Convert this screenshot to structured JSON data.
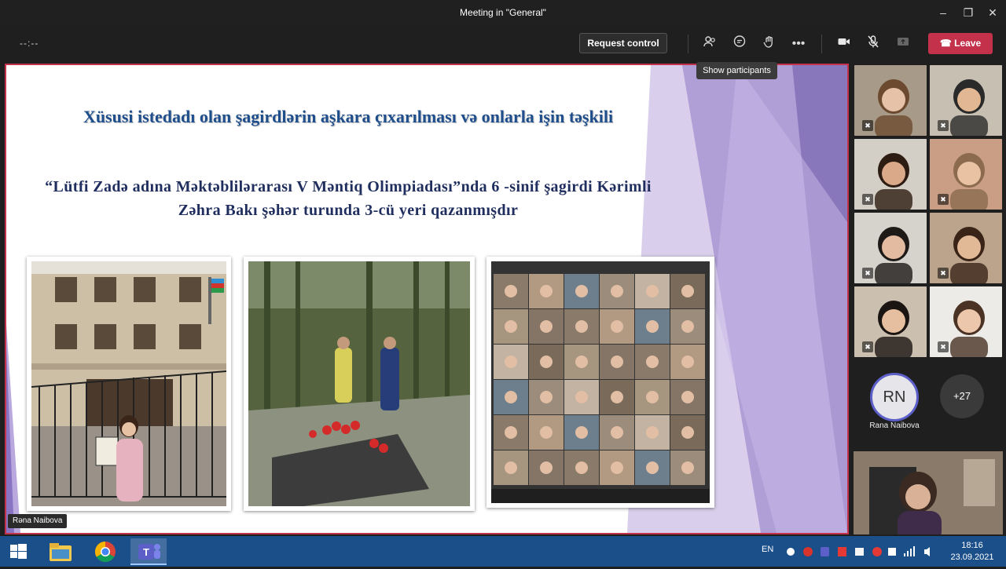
{
  "window": {
    "title": "Meeting in \"General\"",
    "minimize_icon": "minimize-icon",
    "restore_icon": "restore-icon",
    "close_icon": "close-icon"
  },
  "toolbar": {
    "timer": "--:--",
    "request_control": "Request control",
    "leave": "Leave",
    "tooltip": "Show participants",
    "icons": [
      "participants-icon",
      "chat-icon",
      "raise-hand-icon",
      "more-options-icon",
      "camera-icon",
      "mic-muted-icon",
      "share-icon"
    ]
  },
  "slide": {
    "title": "Xüsusi istedadı olan şagirdlərin aşkara çıxarılması və onlarla işin təşkili",
    "subtitle": "“Lütfi Zadə adına Məktəblilərarası  V Məntiq Olimpiadası”nda 6 -sinif şagirdi Kərimli Zəhra Bakı şəhər turunda 3-cü yeri qazanmışdır",
    "photos": [
      "school-building-photo",
      "memorial-photo",
      "video-call-collage-photo"
    ],
    "presenter": "Rəna Naibova"
  },
  "participants": {
    "tiles": [
      {
        "name": "participant-1",
        "bg": "#a89a88",
        "face": "#e6c3a8",
        "hair": "#6b4a2f"
      },
      {
        "name": "participant-2",
        "bg": "#c7c0b2",
        "face": "#e2b894",
        "hair": "#2a2a2a"
      },
      {
        "name": "participant-3",
        "bg": "#d4cfc6",
        "face": "#d9a98a",
        "hair": "#2d1c12"
      },
      {
        "name": "participant-4",
        "bg": "#c99e84",
        "face": "#e9c2a4",
        "hair": "#8b6a4e"
      },
      {
        "name": "participant-5",
        "bg": "#d6d2cc",
        "face": "#e3bba0",
        "hair": "#1e1a18"
      },
      {
        "name": "participant-6",
        "bg": "#bca48c",
        "face": "#e2b996",
        "hair": "#3a2418"
      },
      {
        "name": "participant-7",
        "bg": "#cbbfb0",
        "face": "#e6bfa0",
        "hair": "#1a1412"
      },
      {
        "name": "participant-8",
        "bg": "#ecebe8",
        "face": "#edc7ac",
        "hair": "#4a3324"
      }
    ],
    "avatar_initials": "RN",
    "avatar_name": "Rana Naibova",
    "more_count": "+27"
  },
  "taskbar": {
    "apps": [
      "start-button",
      "file-explorer-icon",
      "chrome-icon",
      "teams-icon"
    ],
    "language": "EN",
    "time": "18:16",
    "date": "23.09.2021"
  }
}
